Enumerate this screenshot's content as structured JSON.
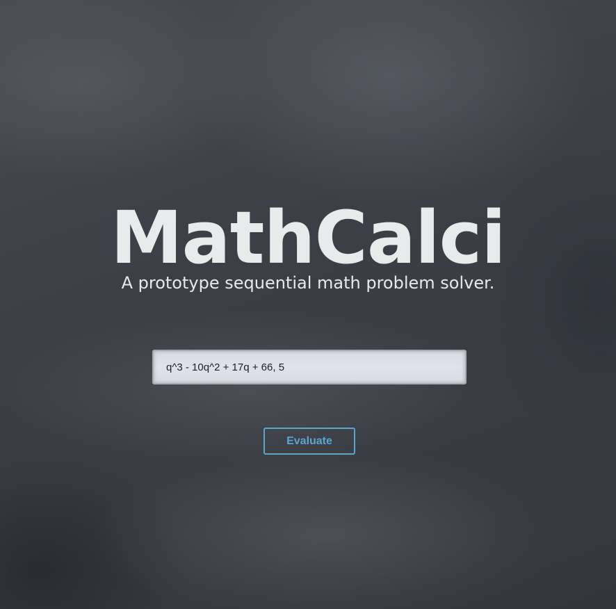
{
  "app": {
    "title": "MathCalci",
    "subtitle": "A prototype sequential math problem solver."
  },
  "form": {
    "expression_value": "q^3 - 10q^2 + 17q + 66, 5",
    "evaluate_label": "Evaluate"
  },
  "colors": {
    "accent": "#5aa6cf",
    "title_text": "#e9eaeb",
    "input_background": "#dcdfe7"
  }
}
